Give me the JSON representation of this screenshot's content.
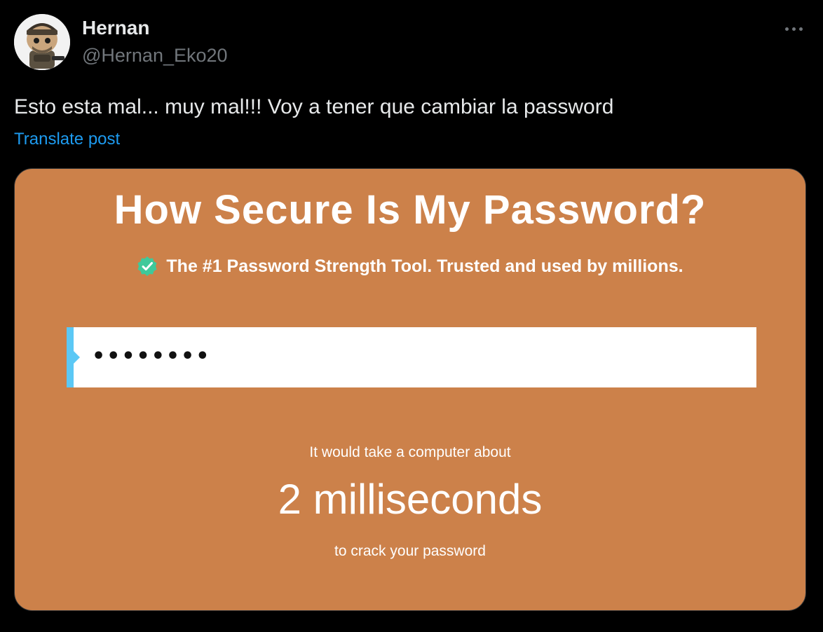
{
  "author": {
    "display_name": "Hernan",
    "handle": "@Hernan_Eko20",
    "avatar_icon": "funko-figure-avatar"
  },
  "more_icon": "more-horizontal-icon",
  "post": {
    "text": "Esto esta mal... muy mal!!! Voy a tener que cambiar la password",
    "translate_label": "Translate post"
  },
  "media": {
    "title": "How Secure Is My Password?",
    "badge_icon": "verified-check-icon",
    "subtitle": "The #1 Password Strength Tool. Trusted and used by millions.",
    "password_mask": "••••••••",
    "result_prefix": "It would take a computer about",
    "result_time": "2 milliseconds",
    "result_suffix": "to crack your password"
  },
  "colors": {
    "background": "#000000",
    "text_primary": "#e7e9ea",
    "text_secondary": "#71767b",
    "link": "#1d9bf0",
    "media_background": "#cc814a",
    "input_accent": "#5bc8f5",
    "check_green": "#3fc99a"
  }
}
